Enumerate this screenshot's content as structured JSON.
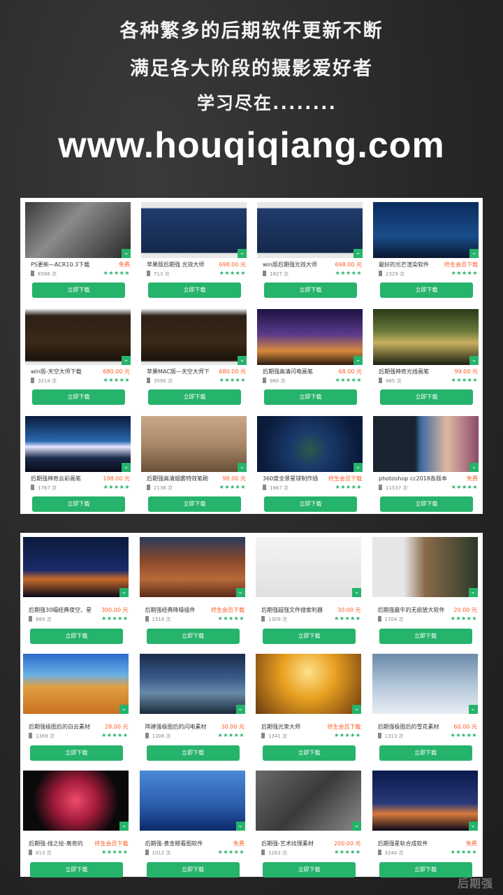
{
  "header": {
    "line1": "各种繁多的后期软件更新不断",
    "line2": "满足各大阶段的摄影爱好者",
    "line3": "学习尽在........",
    "url": "www.houqiqiang.com"
  },
  "button_label": "立即下载",
  "stars": "★★★★★",
  "panel1": [
    {
      "title": "PS更新—ACR10.3下载",
      "price": "免费",
      "count": "6568 次"
    },
    {
      "title": "苹果版后期强 光效大师",
      "price": "698.00 元",
      "count": "713 次"
    },
    {
      "title": "win版后期强光效大师",
      "price": "698.00 元",
      "count": "1827 次"
    },
    {
      "title": "最好的光芒渲染软件",
      "price": "终生会员下载",
      "count": "2329 次"
    },
    {
      "title": "win版-天空大师下载",
      "price": "680.00 元",
      "count": "3214 次"
    },
    {
      "title": "苹果MAC版—天空大师下",
      "price": "680.00 元",
      "count": "3590 次"
    },
    {
      "title": "后期强高清闪电画笔",
      "price": "68.00 元",
      "count": "960 次"
    },
    {
      "title": "后期强神奇光线画笔",
      "price": "99.00 元",
      "count": "965 次"
    },
    {
      "title": "后期强神奇云彩画笔",
      "price": "198.00 元",
      "count": "1767 次"
    },
    {
      "title": "后期强高清烟雾特效笔刷",
      "price": "98.00 元",
      "count": "2136 次"
    },
    {
      "title": "360度全景星球制作插",
      "price": "终生会员下载",
      "count": "1867 次"
    },
    {
      "title": "photoshop cc2018各版本下载",
      "price": "免费",
      "count": "11537 次"
    }
  ],
  "panel2": [
    {
      "title": "后期强30幅经典夜空、星",
      "price": "300.00 元",
      "count": "889 次"
    },
    {
      "title": "后期强经典降噪插件",
      "price": "终生会员下载",
      "count": "1516 次"
    },
    {
      "title": "后期强超强文件搜索利器",
      "price": "30.00 元",
      "count": "1309 次"
    },
    {
      "title": "后期强最牛的无损放大软件",
      "price": "20.00 元",
      "count": "1704 次"
    },
    {
      "title": "后期强极图后的白云素材",
      "price": "28.00 元",
      "count": "1369 次"
    },
    {
      "title": "阵建强极图后的闪电素材",
      "price": "30.00 元",
      "count": "1306 次"
    },
    {
      "title": "后期强光束大师",
      "price": "终生会员下载",
      "count": "1341 次"
    },
    {
      "title": "后期强极图后的雪花素材",
      "price": "60.00 元",
      "count": "1313 次"
    },
    {
      "title": "后期强-线之绘-离奇的",
      "price": "终生会员下载",
      "count": "813 次"
    },
    {
      "title": "后期强-黄金眼看图软件",
      "price": "免费",
      "count": "1012 次"
    },
    {
      "title": "后期强-艺术纹理素材",
      "price": "200.00 元",
      "count": "1283 次"
    },
    {
      "title": "后期强星轨合成软件",
      "price": "免费",
      "count": "3244 次"
    }
  ],
  "watermark": "后期强",
  "colors": {
    "accent_green": "#26b36b",
    "price_orange": "#ff5a1f"
  }
}
